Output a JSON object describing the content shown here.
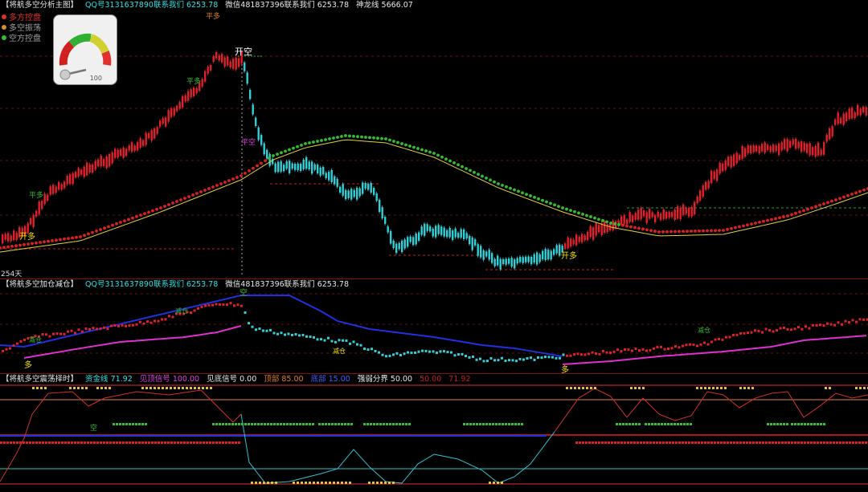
{
  "pane1": {
    "title": "【将航多空分析主图】",
    "qq": "QQ号3131637890联系我们 6253.78",
    "wechat": "微信481837396联系我们 6253.78",
    "dragon_label": "神龙线 5666.07",
    "legend": [
      {
        "label": "多方控盘",
        "color": "#e03030"
      },
      {
        "label": "多空振荡",
        "color": "#d09030"
      },
      {
        "label": "空方控盘",
        "color": "#30c030"
      }
    ],
    "gauge_max": "100",
    "days_label": "254天",
    "signals": {
      "open_long_1": "开多",
      "open_short": "开空",
      "open_long_2": "开多",
      "flat_long_1": "平多",
      "flat_long_2": "平多",
      "flat_short": "平空",
      "top_sign": "平多"
    }
  },
  "pane2": {
    "title": "【将航多空加仓减仓】",
    "qq": "QQ号3131637890联系我们 6253.78",
    "wechat": "微信481837396联系我们 6253.78",
    "signals": {
      "long_1": "多",
      "long_2": "多",
      "short": "空",
      "reduce": "减仓"
    }
  },
  "pane3": {
    "title": "【将航多空震荡择时】",
    "fund_line": "资金线 71.92",
    "top_signal": "见顶信号 100.00",
    "bottom_signal": "见底信号 0.00",
    "top_level": "顶部 85.00",
    "bottom_level": "底部 15.00",
    "strength_divider": "强弱分界 50.00",
    "val_50": "50.00",
    "val_71": "71.92",
    "mark_short": "空"
  },
  "colors": {
    "bull": "#e0202a",
    "bear": "#30d0d8",
    "background": "#000000",
    "grid": "#7a1010"
  }
}
